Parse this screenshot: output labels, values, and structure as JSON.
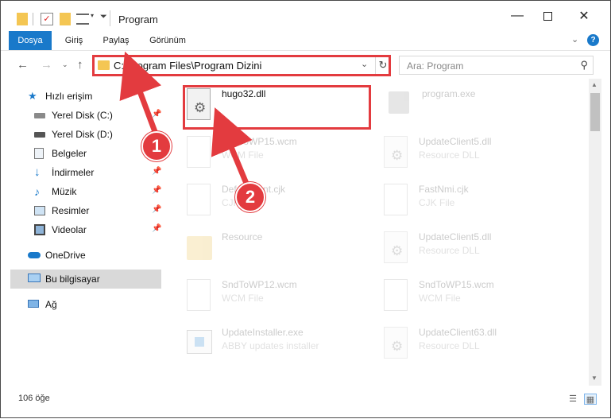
{
  "window": {
    "title": "Program"
  },
  "titlebar": {
    "minimize_icon": "minimize-icon",
    "maximize_icon": "maximize-icon",
    "close_icon": "close-icon"
  },
  "ribbon": {
    "tabs": [
      {
        "label": "Dosya"
      },
      {
        "label": "Giriş"
      },
      {
        "label": "Paylaş"
      },
      {
        "label": "Görünüm"
      }
    ]
  },
  "address": {
    "path": "C:\\Program Files\\Program Dizini"
  },
  "search": {
    "placeholder": "Ara: Program"
  },
  "sidebar": {
    "items": [
      {
        "label": "Hızlı erişim",
        "icon": "star-icon"
      },
      {
        "label": "Yerel Disk (C:)",
        "icon": "drive-icon"
      },
      {
        "label": "Yerel Disk (D:)",
        "icon": "drive-icon"
      },
      {
        "label": "Belgeler",
        "icon": "documents-icon"
      },
      {
        "label": "İndirmeler",
        "icon": "download-icon"
      },
      {
        "label": "Müzik",
        "icon": "music-icon"
      },
      {
        "label": "Resimler",
        "icon": "pictures-icon"
      },
      {
        "label": "Videolar",
        "icon": "video-icon"
      },
      {
        "label": "OneDrive",
        "icon": "cloud-icon"
      },
      {
        "label": "Bu bilgisayar",
        "icon": "computer-icon"
      },
      {
        "label": "Ağ",
        "icon": "network-icon"
      }
    ]
  },
  "files": [
    {
      "name": "hugo32.dll",
      "type": ""
    },
    {
      "name": "program.exe",
      "type": ""
    },
    {
      "name": "SndToWP15.wcm",
      "type": "WCM File"
    },
    {
      "name": "UpdateClient5.dll",
      "type": "Resource DLL"
    },
    {
      "name": "DefaultFont.cjk",
      "type": "CJK File"
    },
    {
      "name": "FastNmi.cjk",
      "type": "CJK File"
    },
    {
      "name": "Resource",
      "type": ""
    },
    {
      "name": "UpdateClient5.dll",
      "type": "Resource DLL"
    },
    {
      "name": "SndToWP12.wcm",
      "type": "WCM File"
    },
    {
      "name": "SndToWP15.wcm",
      "type": "WCM File"
    },
    {
      "name": "UpdateInstaller.exe",
      "type": "ABBY updates installer"
    },
    {
      "name": "UpdateClient63.dll",
      "type": "Resource DLL"
    }
  ],
  "status": {
    "count": "106 öğe"
  },
  "annotations": {
    "step1": "1",
    "step2": "2"
  },
  "colors": {
    "accent": "#1979ca",
    "highlight": "#e33b3f"
  }
}
